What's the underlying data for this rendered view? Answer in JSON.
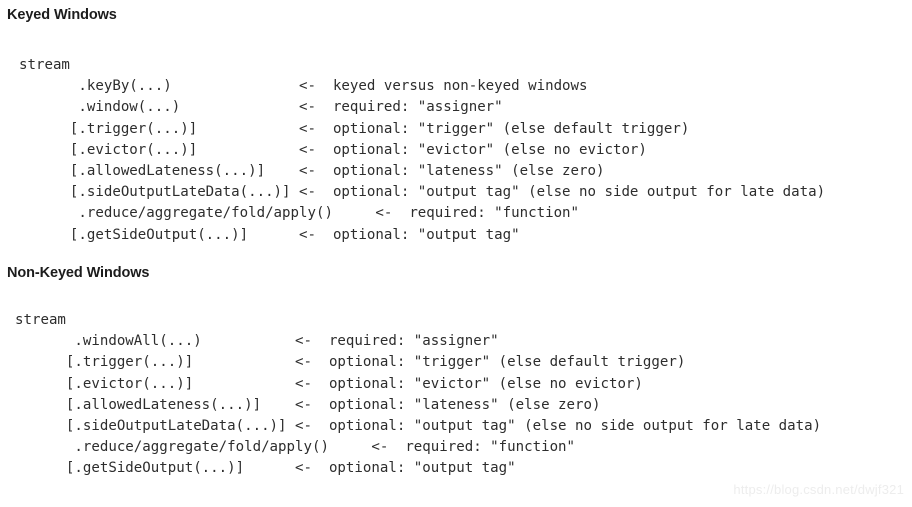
{
  "page": {
    "background_color": "#ffffff",
    "text_color": "#2d2d2d",
    "heading_color": "#1c1c1c",
    "watermark_color": "#ededed"
  },
  "sections": [
    {
      "heading": "Keyed Windows",
      "code_lines": [
        "stream",
        "       .keyBy(...)               <-  keyed versus non-keyed windows",
        "       .window(...)              <-  required: \"assigner\"",
        "      [.trigger(...)]            <-  optional: \"trigger\" (else default trigger)",
        "      [.evictor(...)]            <-  optional: \"evictor\" (else no evictor)",
        "      [.allowedLateness(...)]    <-  optional: \"lateness\" (else zero)",
        "      [.sideOutputLateData(...)] <-  optional: \"output tag\" (else no side output for late data)",
        "       .reduce/aggregate/fold/apply()     <-  required: \"function\"",
        "      [.getSideOutput(...)]      <-  optional: \"output tag\""
      ]
    },
    {
      "heading": "Non-Keyed Windows",
      "code_lines": [
        "stream",
        "       .windowAll(...)           <-  required: \"assigner\"",
        "      [.trigger(...)]            <-  optional: \"trigger\" (else default trigger)",
        "      [.evictor(...)]            <-  optional: \"evictor\" (else no evictor)",
        "      [.allowedLateness(...)]    <-  optional: \"lateness\" (else zero)",
        "      [.sideOutputLateData(...)] <-  optional: \"output tag\" (else no side output for late data)",
        "       .reduce/aggregate/fold/apply()     <-  required: \"function\"",
        "      [.getSideOutput(...)]      <-  optional: \"output tag\""
      ]
    }
  ],
  "watermark": {
    "text": "https://blog.csdn.net/dwjf321"
  }
}
